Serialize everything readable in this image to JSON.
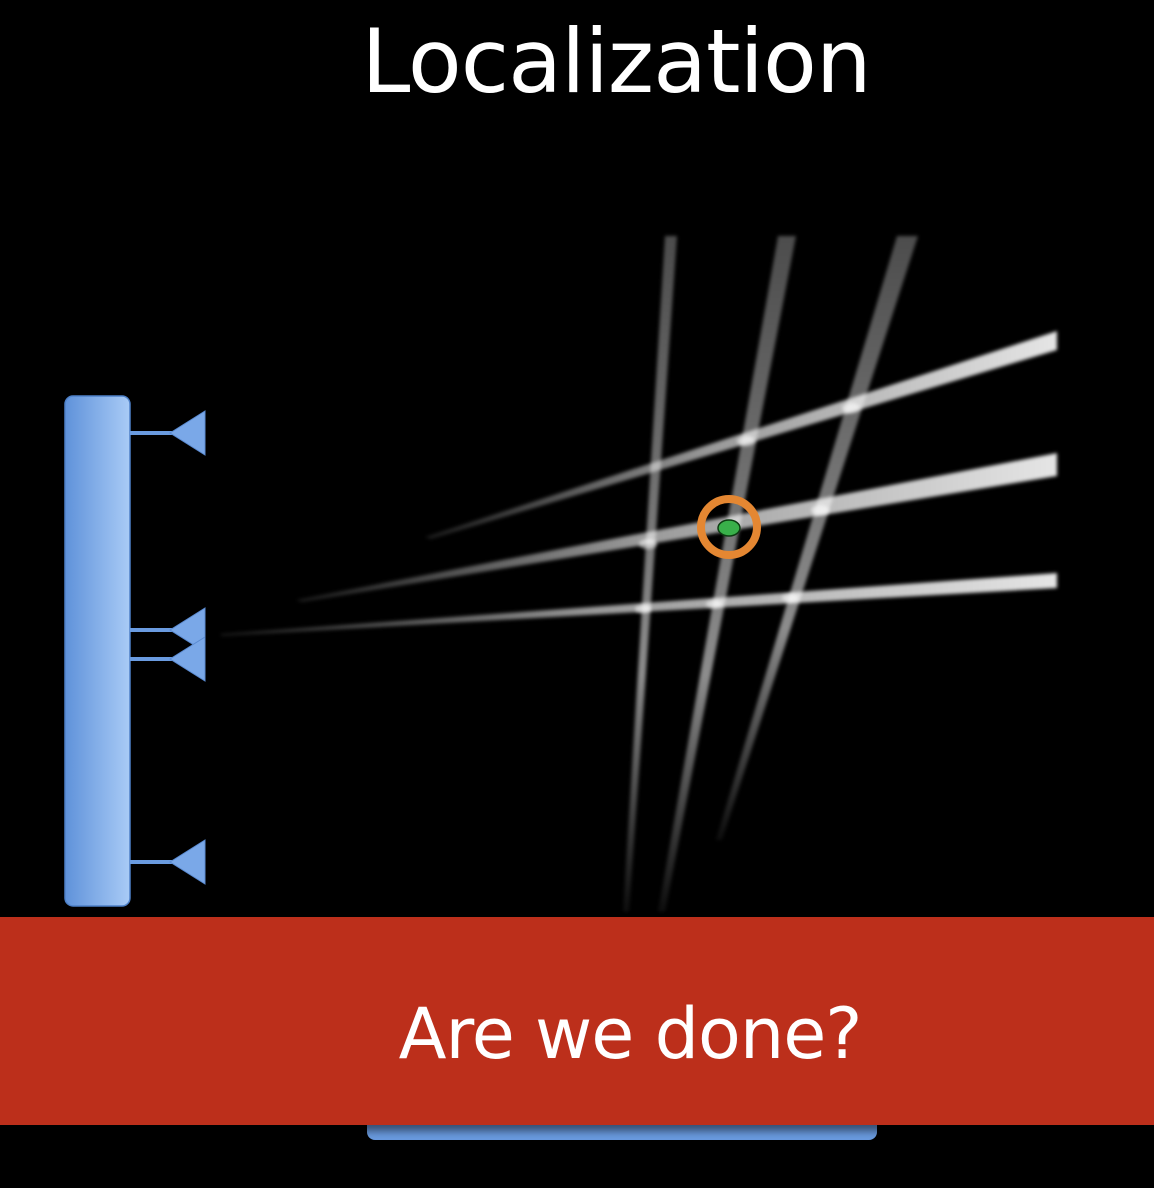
{
  "slide": {
    "title": "Localization",
    "banner_text": "Are we done?"
  },
  "colors": {
    "background": "#000000",
    "array_blue": "#7aa8e8",
    "banner_red": "#bc2f1b",
    "target_ring": "#e48732",
    "target_dot": "#39b04a"
  },
  "icons": {
    "sensor": "triangle-arrow-left",
    "target": "circled-dot"
  }
}
